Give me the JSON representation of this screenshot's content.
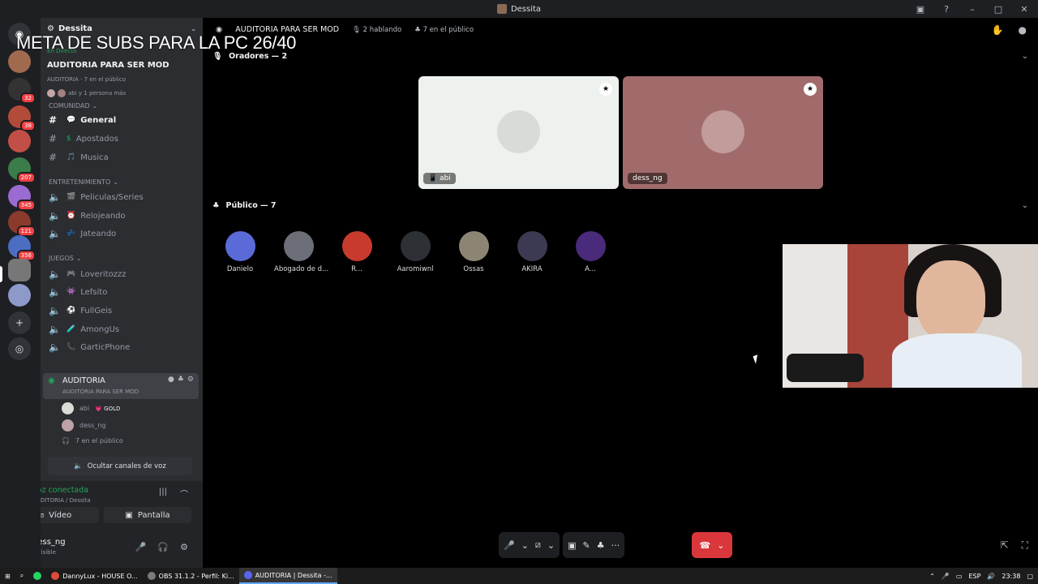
{
  "window": {
    "title": "Dessita"
  },
  "overlay_text": "META DE SUBS PARA LA PC 26/40",
  "server_rail": {
    "badges": [
      "32",
      "38",
      "207",
      "345",
      "121",
      "356"
    ]
  },
  "sidebar": {
    "server_name": "Dessita",
    "event": {
      "live_label": "En Directo",
      "title": "AUDITORIA PARA SER MOD",
      "meta": "AUDITORIA · 7 en el público",
      "attendees": "abi y 1 persona más"
    },
    "categories": [
      {
        "label": "COMUNIDAD",
        "channels": [
          {
            "name": "General",
            "emoji": "💬",
            "type": "text",
            "active": true
          },
          {
            "name": "Apostados",
            "emoji": "$",
            "type": "text"
          },
          {
            "name": "Musica",
            "emoji": "🎵",
            "type": "text"
          }
        ]
      },
      {
        "label": "ENTRETENIMIENTO",
        "channels": [
          {
            "name": "Peliculas/Series",
            "emoji": "🎬",
            "type": "voice"
          },
          {
            "name": "Relojeando",
            "emoji": "⏰",
            "type": "voice"
          },
          {
            "name": "Jateando",
            "emoji": "💤",
            "type": "voice"
          }
        ]
      },
      {
        "label": "JUEGOS",
        "channels": [
          {
            "name": "Loveritozzz",
            "emoji": "🎮",
            "type": "voice"
          },
          {
            "name": "Lefsito",
            "emoji": "👾",
            "type": "voice"
          },
          {
            "name": "FullGeis",
            "emoji": "⚽",
            "type": "voice"
          },
          {
            "name": "AmongUs",
            "emoji": "🧪",
            "type": "voice"
          },
          {
            "name": "GarticPhone",
            "emoji": "📞",
            "type": "voice"
          }
        ]
      }
    ],
    "voice_channel": {
      "name": "AUDITORIA",
      "subtitle": "AUDITORIA PARA SER MOD",
      "users": [
        {
          "name": "abi",
          "tag": "GOLD"
        },
        {
          "name": "dess_ng",
          "tag": ""
        }
      ],
      "audience": "7 en el público"
    },
    "hide_voice_label": "Ocultar canales de voz",
    "connection": {
      "status": "Voz conectada",
      "location": "AUDITORIA / Dessita",
      "video_label": "Vídeo",
      "screen_label": "Pantalla"
    },
    "user": {
      "name": "dess_ng",
      "status": "Invisible"
    }
  },
  "stage": {
    "title": "AUDITORIA PARA SER MOD",
    "speaking": "2 hablando",
    "audience": "7 en el público",
    "speakers_header": "Oradores — 2",
    "speakers": [
      {
        "name": "abi",
        "bg": "#eef2ef",
        "avatar": "#d8dcd6"
      },
      {
        "name": "dess_ng",
        "bg": "#a26b6b",
        "avatar": "#c29b9b"
      }
    ],
    "audience_header": "Público — 7",
    "audience_members": [
      {
        "name": "Danielo",
        "color": "#5a6bd8"
      },
      {
        "name": "Abogado de d...",
        "color": "#6d6f78"
      },
      {
        "name": "R...",
        "color": "#c83a2e"
      },
      {
        "name": "Aaromiwnl",
        "color": "#2d3035"
      },
      {
        "name": "Ossas",
        "color": "#8d8574"
      },
      {
        "name": "AKIRA",
        "color": "#3b3a52"
      },
      {
        "name": "A...",
        "color": "#4a2a7a"
      }
    ]
  },
  "taskbar": {
    "items": [
      {
        "label": "DannyLux - HOUSE O...",
        "color": "#e04a3a"
      },
      {
        "label": "OBS 31.1.2 - Perfil: Ki...",
        "color": "#7b7b7b"
      },
      {
        "label": "AUDITORIA | Dessita -...",
        "color": "#5865f2",
        "active": true
      }
    ],
    "lang": "ESP",
    "time": "23:38"
  }
}
